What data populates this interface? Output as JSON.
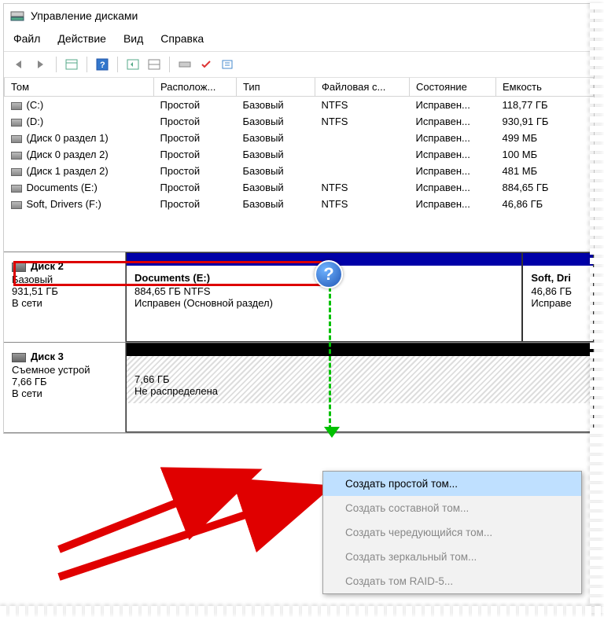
{
  "title": "Управление дисками",
  "menu": {
    "file": "Файл",
    "action": "Действие",
    "view": "Вид",
    "help": "Справка"
  },
  "columns": {
    "vol": "Том",
    "layout": "Располож...",
    "type": "Тип",
    "fs": "Файловая с...",
    "status": "Состояние",
    "capacity": "Емкость"
  },
  "volumes": [
    {
      "name": "(C:)",
      "layout": "Простой",
      "type": "Базовый",
      "fs": "NTFS",
      "status": "Исправен...",
      "cap": "118,77 ГБ"
    },
    {
      "name": "(D:)",
      "layout": "Простой",
      "type": "Базовый",
      "fs": "NTFS",
      "status": "Исправен...",
      "cap": "930,91 ГБ"
    },
    {
      "name": "(Диск 0 раздел 1)",
      "layout": "Простой",
      "type": "Базовый",
      "fs": "",
      "status": "Исправен...",
      "cap": "499 МБ"
    },
    {
      "name": "(Диск 0 раздел 2)",
      "layout": "Простой",
      "type": "Базовый",
      "fs": "",
      "status": "Исправен...",
      "cap": "100 МБ"
    },
    {
      "name": "(Диск 1 раздел 2)",
      "layout": "Простой",
      "type": "Базовый",
      "fs": "",
      "status": "Исправен...",
      "cap": "481 МБ"
    },
    {
      "name": "Documents (E:)",
      "layout": "Простой",
      "type": "Базовый",
      "fs": "NTFS",
      "status": "Исправен...",
      "cap": "884,65 ГБ"
    },
    {
      "name": "Soft, Drivers (F:)",
      "layout": "Простой",
      "type": "Базовый",
      "fs": "NTFS",
      "status": "Исправен...",
      "cap": "46,86 ГБ"
    }
  ],
  "disk2": {
    "name": "Диск 2",
    "type": "Базовый",
    "size": "931,51 ГБ",
    "status": "В сети",
    "vol1": {
      "name": "Documents  (E:)",
      "line2": "884,65 ГБ NTFS",
      "line3": "Исправен (Основной раздел)"
    },
    "vol2": {
      "name": "Soft, Dri",
      "line2": "46,86 ГБ",
      "line3": "Исправе"
    }
  },
  "disk3": {
    "name": "Диск 3",
    "type": "Съемное устрой",
    "size": "7,66 ГБ",
    "status": "В сети",
    "vol1": {
      "line2": "7,66 ГБ",
      "line3": "Не распределена"
    }
  },
  "ctx": {
    "simple": "Создать простой том...",
    "spanned": "Создать составной том...",
    "striped": "Создать чередующийся том...",
    "mirror": "Создать зеркальный том...",
    "raid5": "Создать том RAID-5..."
  },
  "help_q": "?"
}
